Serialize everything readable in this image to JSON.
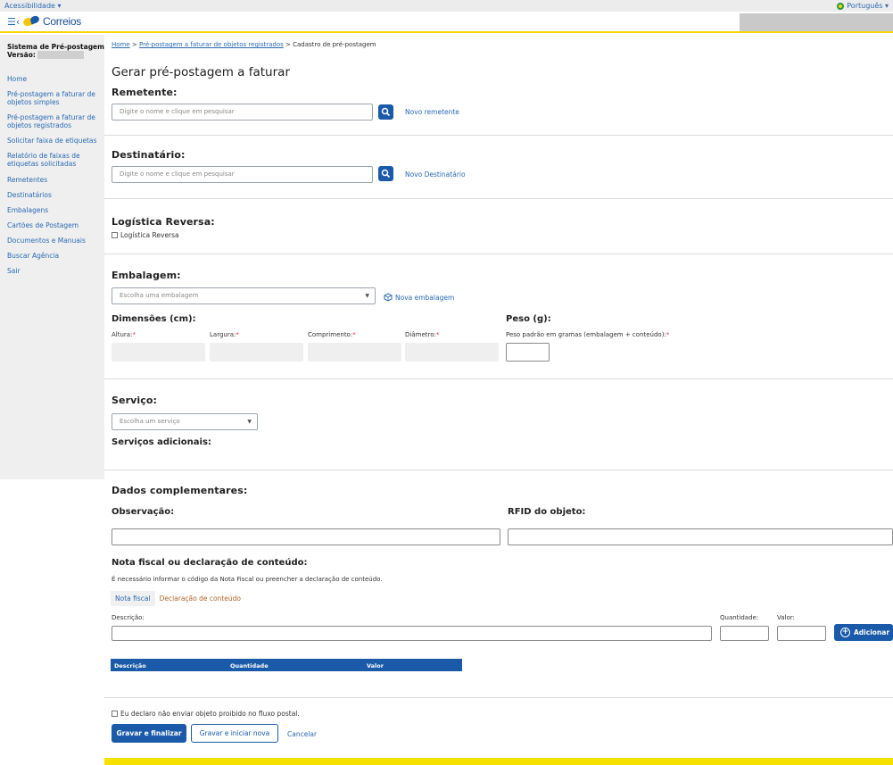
{
  "topbar": {
    "accessibility": "Acessibilidade ▾",
    "language": "Português ▾"
  },
  "header": {
    "logo_text": "Correios"
  },
  "sidebar": {
    "system_title": "Sistema de Pré-postagem",
    "version_label": "Versão:",
    "items": [
      "Home",
      "Pré-postagem a faturar de objetos simples",
      "Pré-postagem a faturar de objetos registrados",
      "Solicitar faixa de etiquetas",
      "Relatório de faixas de etiquetas solicitadas",
      "Remetentes",
      "Destinatários",
      "Embalagens",
      "Cartões de Postagem",
      "Documentos e Manuais",
      "Buscar Agência",
      "Sair"
    ]
  },
  "breadcrumb": {
    "home": "Home",
    "sep1": " > ",
    "parent": "Pré-postagem a faturar de objetos registrados",
    "sep2": " > ",
    "current": "Cadastro de pré-postagem"
  },
  "page_title": "Gerar pré-postagem a faturar",
  "remetente": {
    "title": "Remetente:",
    "placeholder": "Digite o nome e clique em pesquisar",
    "new_link": "Novo remetente"
  },
  "destinatario": {
    "title": "Destinatário:",
    "placeholder": "Digite o nome e clique em pesquisar",
    "new_link": "Novo Destinatário"
  },
  "logistica": {
    "title": "Logística Reversa:",
    "checkbox_label": "Logística Reversa"
  },
  "embalagem": {
    "title": "Embalagem:",
    "select_value": "Escolha uma embalagem",
    "new_link": "Nova embalagem",
    "dim_title": "Dimensões (cm):",
    "altura": "Altura:",
    "largura": "Largura:",
    "comprimento": "Comprimento:",
    "diametro": "Diâmetro:",
    "req": "*",
    "peso_title": "Peso (g):",
    "peso_label": "Peso padrão em gramas (embalagem + conteúdo):"
  },
  "servico": {
    "title": "Serviço:",
    "select_value": "Escolha um serviço",
    "adicionais": "Serviços adicionais:"
  },
  "complementares": {
    "title": "Dados complementares:",
    "observacao": "Observação:",
    "rfid": "RFID do objeto:"
  },
  "nota": {
    "title": "Nota fiscal ou declaração de conteúdo:",
    "info": "É necessário informar o código da Nota Fiscal ou preencher a declaração de conteúdo.",
    "tab_nota": "Nota fiscal",
    "tab_decl": "Declaração de conteúdo",
    "descricao": "Descrição:",
    "quantidade": "Quantidade:",
    "valor": "Valor:",
    "add_button": "Adicionar",
    "table_headers": [
      "Descrição",
      "Quantidade",
      "Valor"
    ]
  },
  "declaro": "Eu declaro não enviar objeto proibido no fluxo postal.",
  "buttons": {
    "gravar_finalizar": "Gravar e finalizar",
    "gravar_nova": "Gravar e iniciar nova",
    "cancelar": "Cancelar"
  },
  "colors": {
    "accent": "#1a5aa8",
    "brand_yellow": "#f6d50c",
    "link": "#2a6ab3"
  }
}
